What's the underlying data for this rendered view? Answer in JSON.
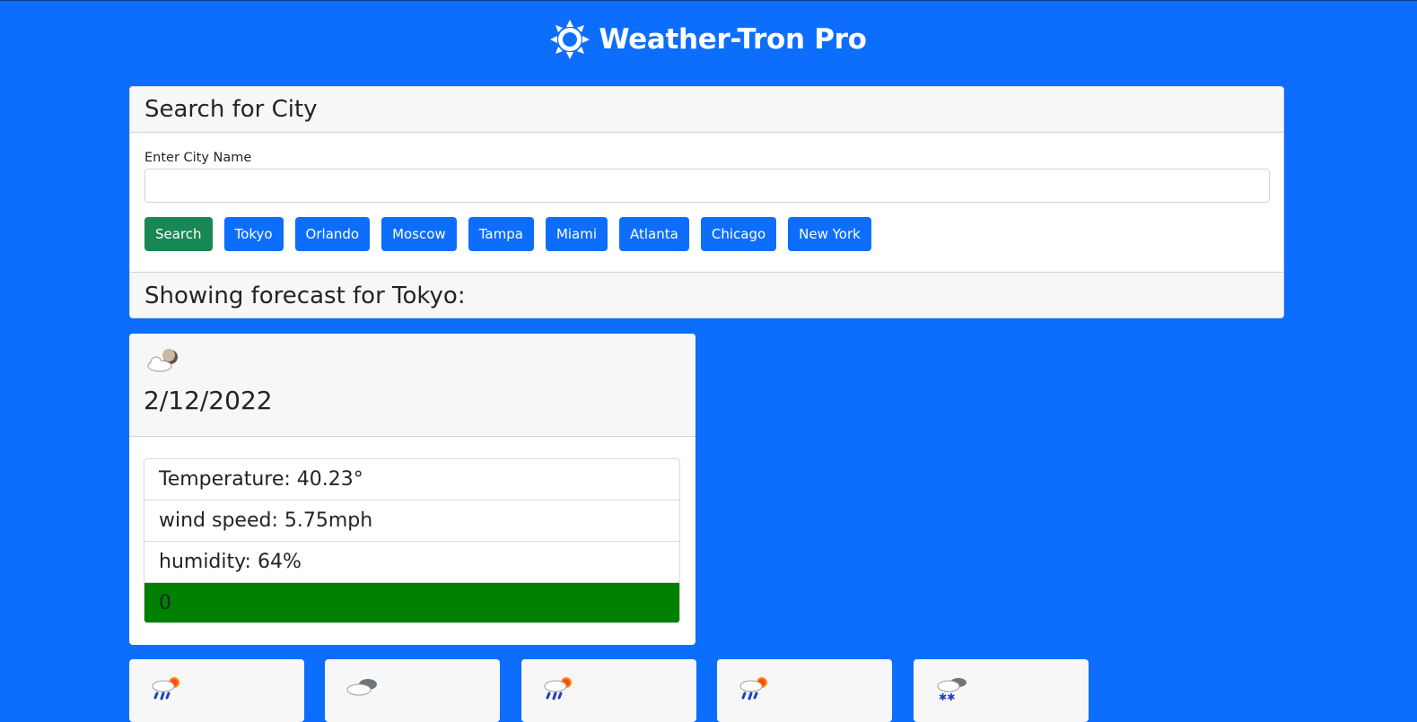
{
  "header": {
    "title": "Weather-Tron Pro",
    "logo_icon": "sun-icon"
  },
  "search": {
    "heading": "Search for City",
    "label": "Enter City Name",
    "input_value": "",
    "search_button": "Search",
    "city_buttons": [
      "Tokyo",
      "Orlando",
      "Moscow",
      "Tampa",
      "Miami",
      "Atlanta",
      "Chicago",
      "New York"
    ]
  },
  "forecast_heading": "Showing forecast for Tokyo:",
  "today": {
    "icon": "cloudy-night-icon",
    "date": "2/12/2022",
    "temperature": "Temperature: 40.23°",
    "wind": "wind speed: 5.75mph",
    "humidity": "humidity: 64%",
    "uv_index": "0"
  },
  "five_day": [
    {
      "icon": "rain-sun-icon"
    },
    {
      "icon": "cloudy-icon"
    },
    {
      "icon": "rain-sun-icon"
    },
    {
      "icon": "rain-sun-icon"
    },
    {
      "icon": "snow-cloud-icon"
    }
  ],
  "colors": {
    "background": "#0d6efd",
    "primary_button": "#0d6efd",
    "search_button": "#198754",
    "uv_low": "#008000"
  }
}
